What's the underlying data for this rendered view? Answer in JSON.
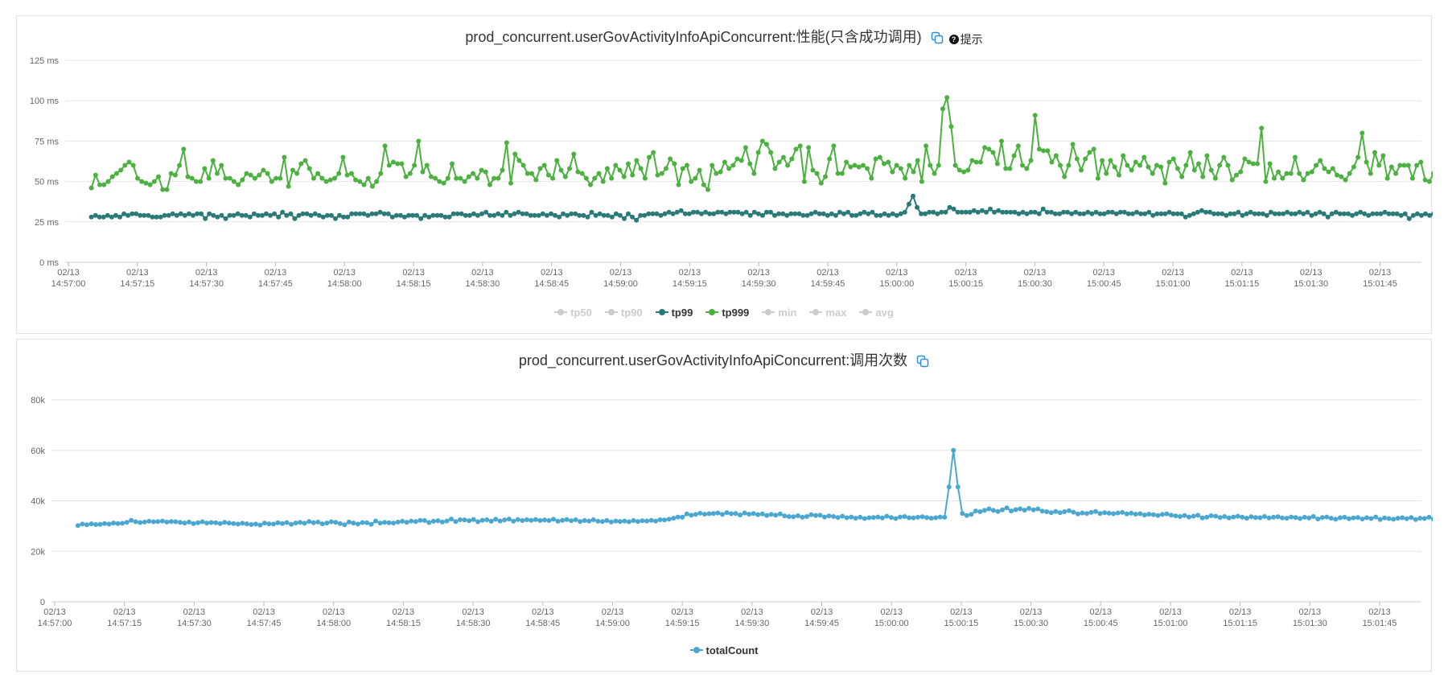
{
  "chart_data": [
    {
      "type": "line",
      "title": "prod_concurrent.userGovActivityInfoApiConcurrent:性能(只含成功调用)",
      "hint_label": "提示",
      "x_ticks": [
        "02/13 14:57:00",
        "02/13 14:57:15",
        "02/13 14:57:30",
        "02/13 14:57:45",
        "02/13 14:58:00",
        "02/13 14:58:15",
        "02/13 14:58:30",
        "02/13 14:58:45",
        "02/13 14:59:00",
        "02/13 14:59:15",
        "02/13 14:59:30",
        "02/13 14:59:45",
        "02/13 15:00:00",
        "02/13 15:00:15",
        "02/13 15:00:30",
        "02/13 15:00:45",
        "02/13 15:01:00",
        "02/13 15:01:15",
        "02/13 15:01:30",
        "02/13 15:01:45"
      ],
      "x_start": "14:57:00",
      "x_end": "15:01:54",
      "y_ticks": [
        "0 ms",
        "25 ms",
        "50 ms",
        "75 ms",
        "100 ms",
        "125 ms"
      ],
      "ylim": [
        0,
        125
      ],
      "grid": true,
      "legend_position": "bottom-center",
      "legend": [
        {
          "name": "tp50",
          "active": false
        },
        {
          "name": "tp90",
          "active": false
        },
        {
          "name": "tp99",
          "active": true
        },
        {
          "name": "tp999",
          "active": true
        },
        {
          "name": "min",
          "active": false
        },
        {
          "name": "max",
          "active": false
        },
        {
          "name": "avg",
          "active": false
        }
      ],
      "series": [
        {
          "name": "tp99",
          "color": "#2a7a78",
          "values": [
            28,
            29,
            28,
            28,
            29,
            28,
            29,
            28,
            30,
            29,
            30,
            30,
            29,
            29,
            29,
            28,
            28,
            28,
            29,
            29,
            30,
            29,
            30,
            29,
            30,
            29,
            30,
            30,
            27,
            30,
            29,
            28,
            29,
            27,
            29,
            29,
            30,
            29,
            29,
            28,
            30,
            29,
            29,
            30,
            29,
            30,
            28,
            31,
            29,
            30,
            27,
            29,
            30,
            30,
            29,
            30,
            29,
            28,
            29,
            29,
            27,
            29,
            28,
            28,
            30,
            30,
            30,
            30,
            29,
            30,
            30,
            31,
            30,
            30,
            28,
            29,
            29,
            28,
            29,
            29,
            29,
            27,
            29,
            28,
            29,
            29,
            29,
            28,
            28,
            30,
            30,
            30,
            29,
            29,
            30,
            29,
            30,
            31,
            29,
            29,
            30,
            29,
            31,
            29,
            30,
            31,
            30,
            30,
            29,
            29,
            29,
            30,
            29,
            30,
            29,
            28,
            30,
            29,
            30,
            30,
            29,
            29,
            28,
            31,
            29,
            30,
            29,
            29,
            28,
            30,
            29,
            27,
            30,
            28,
            26,
            29,
            29,
            30,
            30,
            30,
            29,
            30,
            31,
            30,
            31,
            32,
            30,
            30,
            31,
            31,
            30,
            31,
            30,
            30,
            31,
            31,
            30,
            31,
            31,
            31,
            30,
            31,
            29,
            31,
            30,
            29,
            31,
            31,
            29,
            30,
            30,
            29,
            30,
            30,
            30,
            29,
            29,
            30,
            31,
            30,
            30,
            29,
            30,
            29,
            31,
            30,
            31,
            29,
            29,
            30,
            31,
            30,
            31,
            29,
            29,
            30,
            29,
            30,
            29,
            30,
            31,
            36,
            41,
            34,
            30,
            30,
            31,
            31,
            30,
            31,
            31,
            34,
            33,
            31,
            31,
            31,
            31,
            32,
            31,
            32,
            31,
            33,
            31,
            32,
            31,
            31,
            31,
            31,
            30,
            31,
            30,
            31,
            31,
            30,
            33,
            31,
            31,
            30,
            30,
            31,
            31,
            30,
            31,
            30,
            30,
            31,
            30,
            31,
            30,
            30,
            31,
            31,
            30,
            31,
            31,
            30,
            30,
            31,
            30,
            30,
            31,
            29,
            30,
            30,
            30,
            31,
            30,
            30,
            30,
            28,
            29,
            30,
            31,
            32,
            31,
            31,
            30,
            30,
            30,
            29,
            30,
            30,
            31,
            29,
            30,
            31,
            30,
            30,
            30,
            29,
            31,
            30,
            30,
            30,
            31,
            30,
            30,
            31,
            30,
            31,
            29,
            30,
            31,
            30,
            28,
            30,
            31,
            30,
            30,
            30,
            29,
            30,
            31,
            30,
            29,
            30,
            30,
            30,
            31,
            30,
            30,
            30,
            29,
            30,
            27,
            29,
            30,
            29,
            30,
            29,
            30,
            29
          ]
        },
        {
          "name": "tp999",
          "color": "#4cb140",
          "values": [
            46,
            54,
            48,
            48,
            50,
            53,
            55,
            57,
            60,
            62,
            60,
            52,
            50,
            49,
            48,
            50,
            53,
            45,
            45,
            55,
            54,
            60,
            70,
            53,
            52,
            50,
            50,
            58,
            52,
            63,
            55,
            60,
            52,
            52,
            50,
            48,
            51,
            55,
            54,
            52,
            54,
            57,
            55,
            50,
            52,
            52,
            65,
            47,
            57,
            55,
            61,
            63,
            58,
            52,
            55,
            52,
            50,
            51,
            52,
            55,
            65,
            54,
            55,
            51,
            50,
            48,
            52,
            47,
            50,
            55,
            72,
            60,
            62,
            61,
            61,
            53,
            55,
            60,
            75,
            56,
            60,
            53,
            52,
            50,
            49,
            52,
            61,
            52,
            52,
            50,
            53,
            55,
            52,
            57,
            56,
            48,
            52,
            52,
            57,
            74,
            49,
            67,
            63,
            60,
            55,
            55,
            51,
            58,
            60,
            54,
            52,
            63,
            57,
            53,
            58,
            67,
            56,
            55,
            52,
            48,
            52,
            55,
            50,
            58,
            52,
            60,
            57,
            53,
            61,
            54,
            63,
            58,
            52,
            65,
            68,
            54,
            55,
            58,
            64,
            61,
            48,
            58,
            60,
            50,
            52,
            57,
            48,
            45,
            60,
            55,
            56,
            62,
            58,
            60,
            64,
            63,
            71,
            61,
            55,
            68,
            75,
            73,
            68,
            58,
            62,
            65,
            60,
            64,
            70,
            72,
            50,
            71,
            57,
            55,
            49,
            53,
            64,
            72,
            55,
            55,
            62,
            59,
            60,
            59,
            60,
            58,
            52,
            64,
            65,
            61,
            62,
            56,
            60,
            58,
            52,
            60,
            56,
            63,
            50,
            72,
            60,
            55,
            60,
            95,
            102,
            84,
            60,
            57,
            56,
            57,
            63,
            62,
            62,
            71,
            70,
            68,
            61,
            75,
            58,
            58,
            66,
            72,
            60,
            58,
            63,
            91,
            70,
            69,
            69,
            62,
            66,
            60,
            53,
            60,
            73,
            64,
            57,
            64,
            68,
            70,
            52,
            63,
            55,
            63,
            59,
            54,
            66,
            60,
            57,
            62,
            60,
            65,
            59,
            55,
            60,
            59,
            49,
            62,
            64,
            58,
            53,
            60,
            68,
            57,
            61,
            53,
            66,
            57,
            52,
            60,
            65,
            60,
            51,
            54,
            56,
            64,
            62,
            61,
            61,
            83,
            50,
            61,
            52,
            56,
            52,
            55,
            55,
            65,
            55,
            51,
            55,
            56,
            60,
            63,
            58,
            56,
            58,
            54,
            53,
            51,
            55,
            59,
            65,
            80,
            62,
            55,
            68,
            60,
            66,
            52,
            59,
            55,
            60,
            60,
            60,
            52,
            60,
            62,
            51,
            50,
            55,
            56
          ]
        }
      ]
    },
    {
      "type": "line",
      "title": "prod_concurrent.userGovActivityInfoApiConcurrent:调用次数",
      "x_ticks": [
        "02/13 14:57:00",
        "02/13 14:57:15",
        "02/13 14:57:30",
        "02/13 14:57:45",
        "02/13 14:58:00",
        "02/13 14:58:15",
        "02/13 14:58:30",
        "02/13 14:58:45",
        "02/13 14:59:00",
        "02/13 14:59:15",
        "02/13 14:59:30",
        "02/13 14:59:45",
        "02/13 15:00:00",
        "02/13 15:00:15",
        "02/13 15:00:30",
        "02/13 15:00:45",
        "02/13 15:01:00",
        "02/13 15:01:15",
        "02/13 15:01:30",
        "02/13 15:01:45"
      ],
      "x_start": "14:57:00",
      "x_end": "15:01:54",
      "y_ticks": [
        "0",
        "20k",
        "40k",
        "60k",
        "80k"
      ],
      "ylim": [
        0,
        80000
      ],
      "grid": true,
      "legend_position": "bottom-center",
      "legend": [
        {
          "name": "totalCount",
          "active": true
        }
      ],
      "series": [
        {
          "name": "totalCount",
          "color": "#4aa8d0",
          "values": [
            30200,
            30800,
            30500,
            30900,
            30600,
            30700,
            31000,
            30800,
            31200,
            31000,
            31100,
            31500,
            32300,
            31700,
            31400,
            31600,
            31900,
            31700,
            31800,
            32000,
            31600,
            31800,
            31700,
            31500,
            31200,
            31600,
            31000,
            31300,
            31700,
            31200,
            31400,
            31300,
            31000,
            31500,
            31200,
            31000,
            30800,
            31100,
            30900,
            30600,
            30800,
            30400,
            31200,
            30900,
            30800,
            31300,
            31000,
            31400,
            30700,
            31200,
            31500,
            31100,
            31800,
            31300,
            31600,
            30900,
            31200,
            31700,
            31500,
            31000,
            30500,
            31600,
            31200,
            30800,
            31400,
            31300,
            30700,
            32000,
            31200,
            31500,
            31300,
            31200,
            31600,
            31900,
            31500,
            32000,
            31800,
            32300,
            32200,
            31400,
            31900,
            32100,
            31600,
            32000,
            32800,
            31800,
            32500,
            32400,
            32100,
            32600,
            31700,
            32300,
            32500,
            31900,
            32700,
            32000,
            32400,
            32800,
            31900,
            32600,
            32200,
            32500,
            32300,
            32600,
            32200,
            32400,
            32200,
            32700,
            31900,
            32300,
            32600,
            32100,
            32500,
            31800,
            32200,
            32000,
            32500,
            31900,
            31800,
            32200,
            31600,
            32000,
            31800,
            32000,
            31700,
            32200,
            31800,
            32100,
            32000,
            32300,
            32000,
            32500,
            32400,
            32700,
            33100,
            33600,
            33500,
            34800,
            34300,
            34600,
            35100,
            34700,
            34900,
            35000,
            35200,
            34600,
            35300,
            34900,
            35000,
            34400,
            35200,
            34700,
            35000,
            34500,
            34800,
            34200,
            34600,
            34300,
            34800,
            34000,
            33800,
            33700,
            34100,
            33500,
            33800,
            34500,
            34200,
            34300,
            33600,
            34000,
            33800,
            33400,
            33900,
            33300,
            33600,
            33100,
            33500,
            33000,
            33300,
            33400,
            33600,
            33200,
            33900,
            33400,
            33000,
            33600,
            33800,
            33300,
            33200,
            33500,
            33700,
            33400,
            33100,
            33300,
            33600,
            33500,
            45500,
            60000,
            45500,
            35000,
            34200,
            34600,
            36000,
            35700,
            36200,
            36800,
            36200,
            35800,
            36400,
            37200,
            36000,
            36500,
            36800,
            36300,
            37000,
            36400,
            36800,
            35900,
            35700,
            35300,
            35800,
            35300,
            35700,
            36100,
            35500,
            34800,
            35200,
            35000,
            35400,
            35800,
            35000,
            35300,
            35100,
            34900,
            35200,
            35400,
            34800,
            35100,
            34700,
            34900,
            34400,
            34700,
            34500,
            34200,
            34600,
            34800,
            34300,
            34000,
            33800,
            34200,
            33600,
            33900,
            34300,
            33200,
            33500,
            34100,
            33900,
            33400,
            33800,
            33200,
            33600,
            33900,
            33500,
            33100,
            33700,
            33400,
            33300,
            33800,
            33200,
            33500,
            33700,
            33200,
            33100,
            33600,
            33400,
            33000,
            33500,
            33200,
            33800,
            32800,
            33400,
            33600,
            33100,
            32700,
            33300,
            33500,
            32900,
            33200,
            33400,
            32800,
            33300,
            33000,
            33600,
            32600,
            33200,
            33000,
            32700,
            33100,
            33300,
            32900,
            33400,
            32600,
            33100,
            33000,
            33500,
            32800,
            32600
          ]
        }
      ]
    }
  ]
}
